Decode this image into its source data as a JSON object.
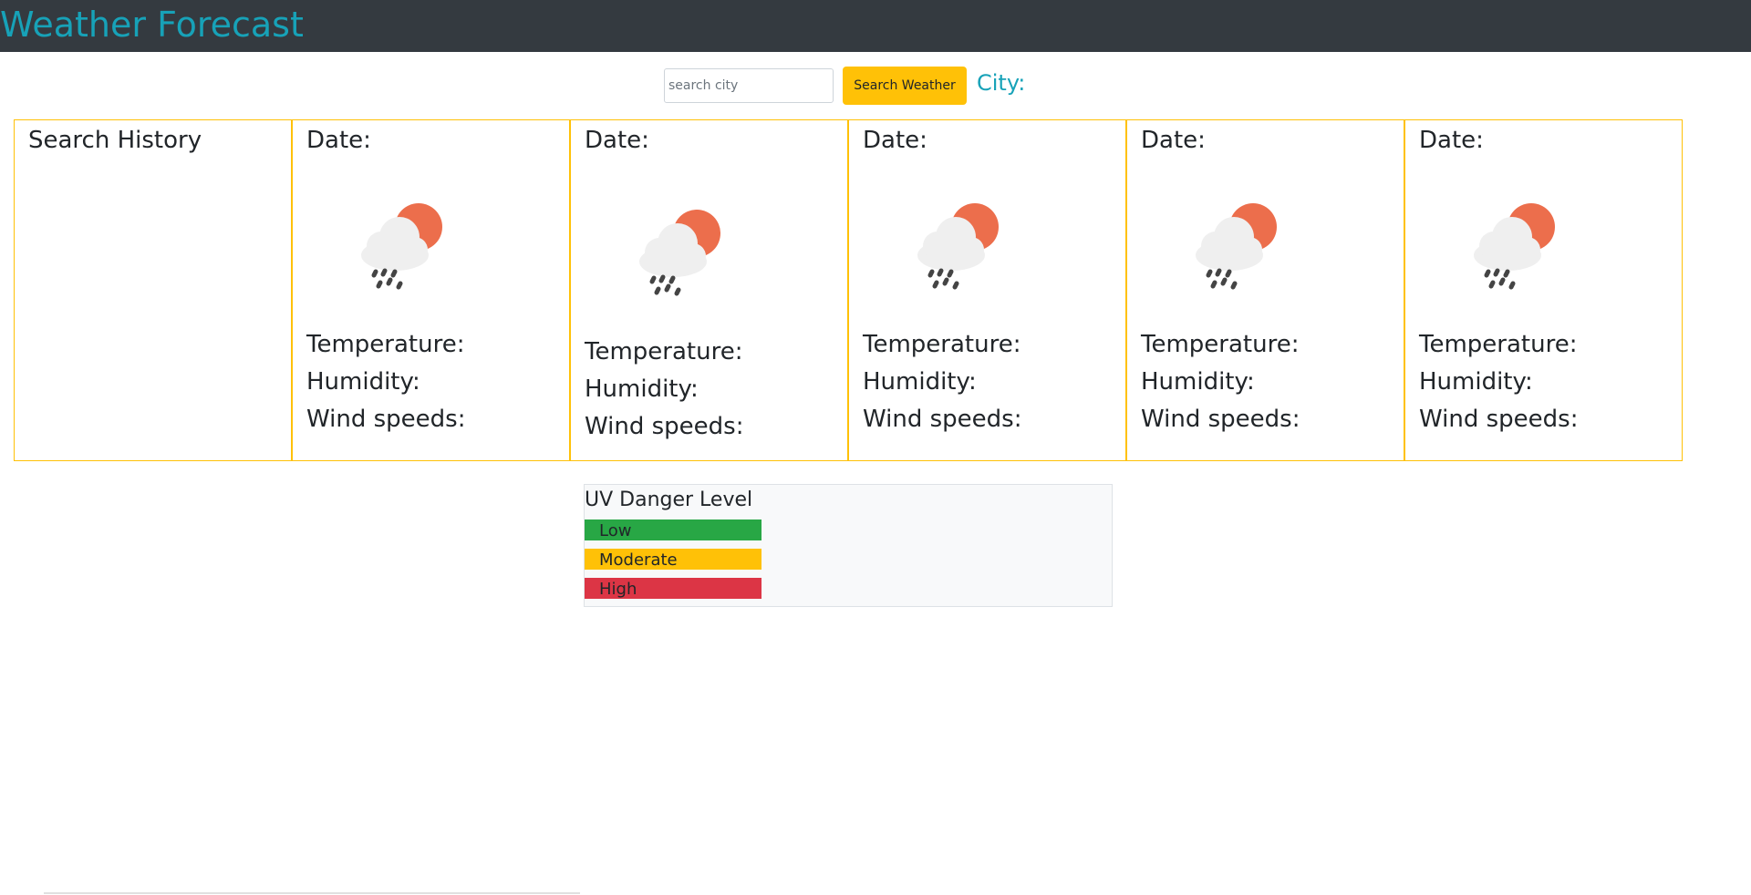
{
  "header": {
    "title": "Weather Forecast",
    "bg_color": "#343a40",
    "title_color": "#17a2b8"
  },
  "search": {
    "placeholder": "search city",
    "value": "",
    "button_label": "Search Weather",
    "button_color": "#ffc107",
    "city_label": "City:"
  },
  "history": {
    "title": "Search History",
    "items": []
  },
  "forecast": [
    {
      "date_label": "Date:",
      "icon": "rain-cloud-sun-icon",
      "temperature_label": "Temperature:",
      "humidity_label": "Humidity:",
      "wind_label": "Wind speeds:"
    },
    {
      "date_label": "Date:",
      "icon": "rain-cloud-sun-icon",
      "temperature_label": "Temperature:",
      "humidity_label": "Humidity:",
      "wind_label": "Wind speeds:"
    },
    {
      "date_label": "Date:",
      "icon": "rain-cloud-sun-icon",
      "temperature_label": "Temperature:",
      "humidity_label": "Humidity:",
      "wind_label": "Wind speeds:"
    },
    {
      "date_label": "Date:",
      "icon": "rain-cloud-sun-icon",
      "temperature_label": "Temperature:",
      "humidity_label": "Humidity:",
      "wind_label": "Wind speeds:"
    },
    {
      "date_label": "Date:",
      "icon": "rain-cloud-sun-icon",
      "temperature_label": "Temperature:",
      "humidity_label": "Humidity:",
      "wind_label": "Wind speeds:"
    }
  ],
  "uv": {
    "title": "UV Danger Level",
    "levels": [
      {
        "label": "Low",
        "color": "#28a745"
      },
      {
        "label": "Moderate",
        "color": "#ffc107"
      },
      {
        "label": "High",
        "color": "#dc3545"
      }
    ]
  }
}
